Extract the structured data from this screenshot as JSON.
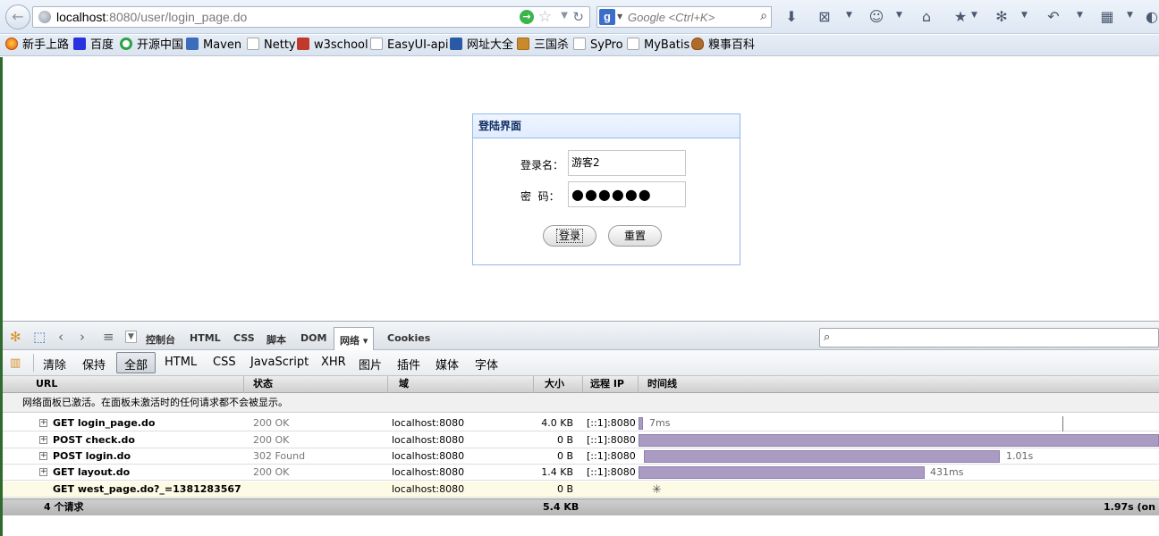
{
  "browser": {
    "url_host": "localhost",
    "url_rest": ":8080/user/login_page.do",
    "search_engine": "g",
    "search_placeholder": "Google <Ctrl+K>"
  },
  "bookmarks": [
    {
      "label": "新手上路",
      "icon": "firefox-icon"
    },
    {
      "label": "百度",
      "icon": "paw-icon"
    },
    {
      "label": "开源中国",
      "icon": "oschina-icon"
    },
    {
      "label": "Maven",
      "icon": "maven-icon"
    },
    {
      "label": "Netty",
      "icon": "page-icon"
    },
    {
      "label": "w3school",
      "icon": "w3-icon"
    },
    {
      "label": "EasyUI-api",
      "icon": "page-icon"
    },
    {
      "label": "网址大全",
      "icon": "house-icon"
    },
    {
      "label": "三国杀",
      "icon": "sgs-icon"
    },
    {
      "label": "SyPro",
      "icon": "page-icon"
    },
    {
      "label": "MyBatis",
      "icon": "page-icon"
    },
    {
      "label": "糗事百科",
      "icon": "poo-icon"
    }
  ],
  "login": {
    "title": "登陆界面",
    "username_label": "登录名：",
    "username_value": "游客2",
    "password_label": "密  码：",
    "password_value": "●●●●●●",
    "login_button": "登录",
    "reset_button": "重置"
  },
  "firebug": {
    "tabs": [
      "控制台",
      "HTML",
      "CSS",
      "脚本",
      "DOM",
      "网络 ▾",
      "Cookies"
    ],
    "active_tab": "网络 ▾",
    "filters": [
      "清除",
      "保持",
      "全部",
      "HTML",
      "CSS",
      "JavaScript",
      "XHR",
      "图片",
      "插件",
      "媒体",
      "字体"
    ],
    "active_filter": "全部",
    "columns": [
      "URL",
      "状态",
      "域",
      "大小",
      "远程 IP",
      "时间线"
    ],
    "notice": "网络面板已激活。在面板未激活时的任何请求都不会被显示。",
    "requests": [
      {
        "url": "GET login_page.do",
        "status": "200 OK",
        "domain": "localhost:8080",
        "size": "4.0 KB",
        "ip": "[::1]:8080",
        "time_label": "7ms"
      },
      {
        "url": "POST check.do",
        "status": "200 OK",
        "domain": "localhost:8080",
        "size": "0 B",
        "ip": "[::1]:8080",
        "time_label": ""
      },
      {
        "url": "POST login.do",
        "status": "302 Found",
        "domain": "localhost:8080",
        "size": "0 B",
        "ip": "[::1]:8080",
        "time_label": "1.01s"
      },
      {
        "url": "GET layout.do",
        "status": "200 OK",
        "domain": "localhost:8080",
        "size": "1.4 KB",
        "ip": "[::1]:8080",
        "time_label": "431ms"
      },
      {
        "url": "GET west_page.do?_=13812835675",
        "status": "",
        "domain": "localhost:8080",
        "size": "0 B",
        "ip": "",
        "time_label": ""
      }
    ],
    "summary": {
      "count": "4 个请求",
      "total_size": "5.4 KB",
      "total_time": "1.97s (on"
    }
  },
  "colors": {
    "panel_border": "#95b8e7",
    "timeline_bar": "#a99bc2",
    "pending_row": "#fdfbe6"
  }
}
